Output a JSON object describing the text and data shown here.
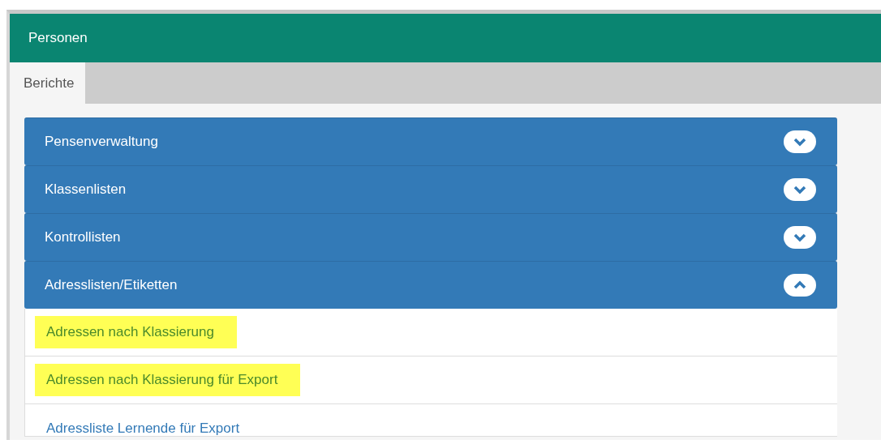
{
  "header": {
    "title": "Personen"
  },
  "tabs": [
    {
      "label": "Berichte",
      "selected": true
    }
  ],
  "sections": [
    {
      "title": "Pensenverwaltung",
      "expanded": false
    },
    {
      "title": "Klassenlisten",
      "expanded": false
    },
    {
      "title": "Kontrollisten",
      "expanded": false
    },
    {
      "title": "Adresslisten/Etiketten",
      "expanded": true,
      "items": [
        {
          "label": "Adressen nach Klassierung",
          "highlighted": true
        },
        {
          "label": "Adressen nach Klassierung für Export",
          "highlighted": true
        },
        {
          "label": "Adressliste Lernende für Export",
          "highlighted": false
        }
      ]
    }
  ]
}
